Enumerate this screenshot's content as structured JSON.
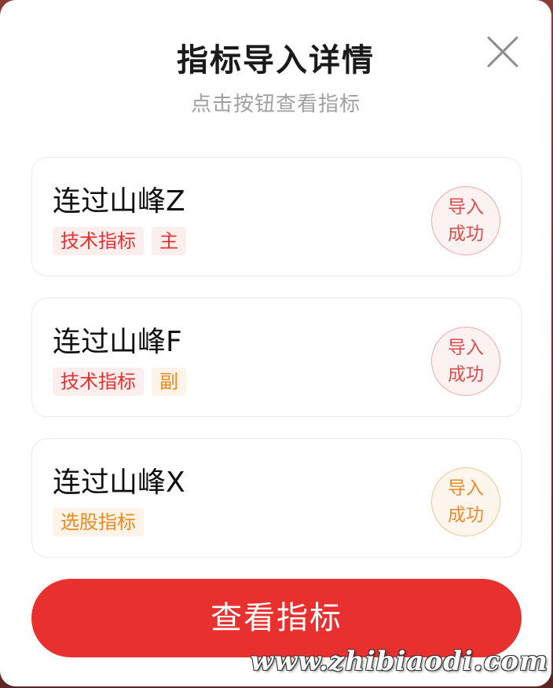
{
  "dialog": {
    "title": "指标导入详情",
    "subtitle": "点击按钮查看指标",
    "close_icon": "close-icon"
  },
  "items": [
    {
      "name": "连过山峰Z",
      "tags": [
        {
          "label": "技术指标",
          "color": "#e63232"
        },
        {
          "label": "主",
          "color": "#e63232"
        }
      ],
      "status_line1": "导入",
      "status_line2": "成功",
      "status_color": "#e04a4a"
    },
    {
      "name": "连过山峰F",
      "tags": [
        {
          "label": "技术指标",
          "color": "#e63232"
        },
        {
          "label": "副",
          "color": "#ef8a1c"
        }
      ],
      "status_line1": "导入",
      "status_line2": "成功",
      "status_color": "#e04a4a"
    },
    {
      "name": "连过山峰X",
      "tags": [
        {
          "label": "选股指标",
          "color": "#ef8a1c"
        }
      ],
      "status_line1": "导入",
      "status_line2": "成功",
      "status_color": "#ec8a28"
    }
  ],
  "footer": {
    "view_button_label": "查看指标",
    "button_color": "#e8312f"
  },
  "watermark": "www.zhibiaodi.com"
}
